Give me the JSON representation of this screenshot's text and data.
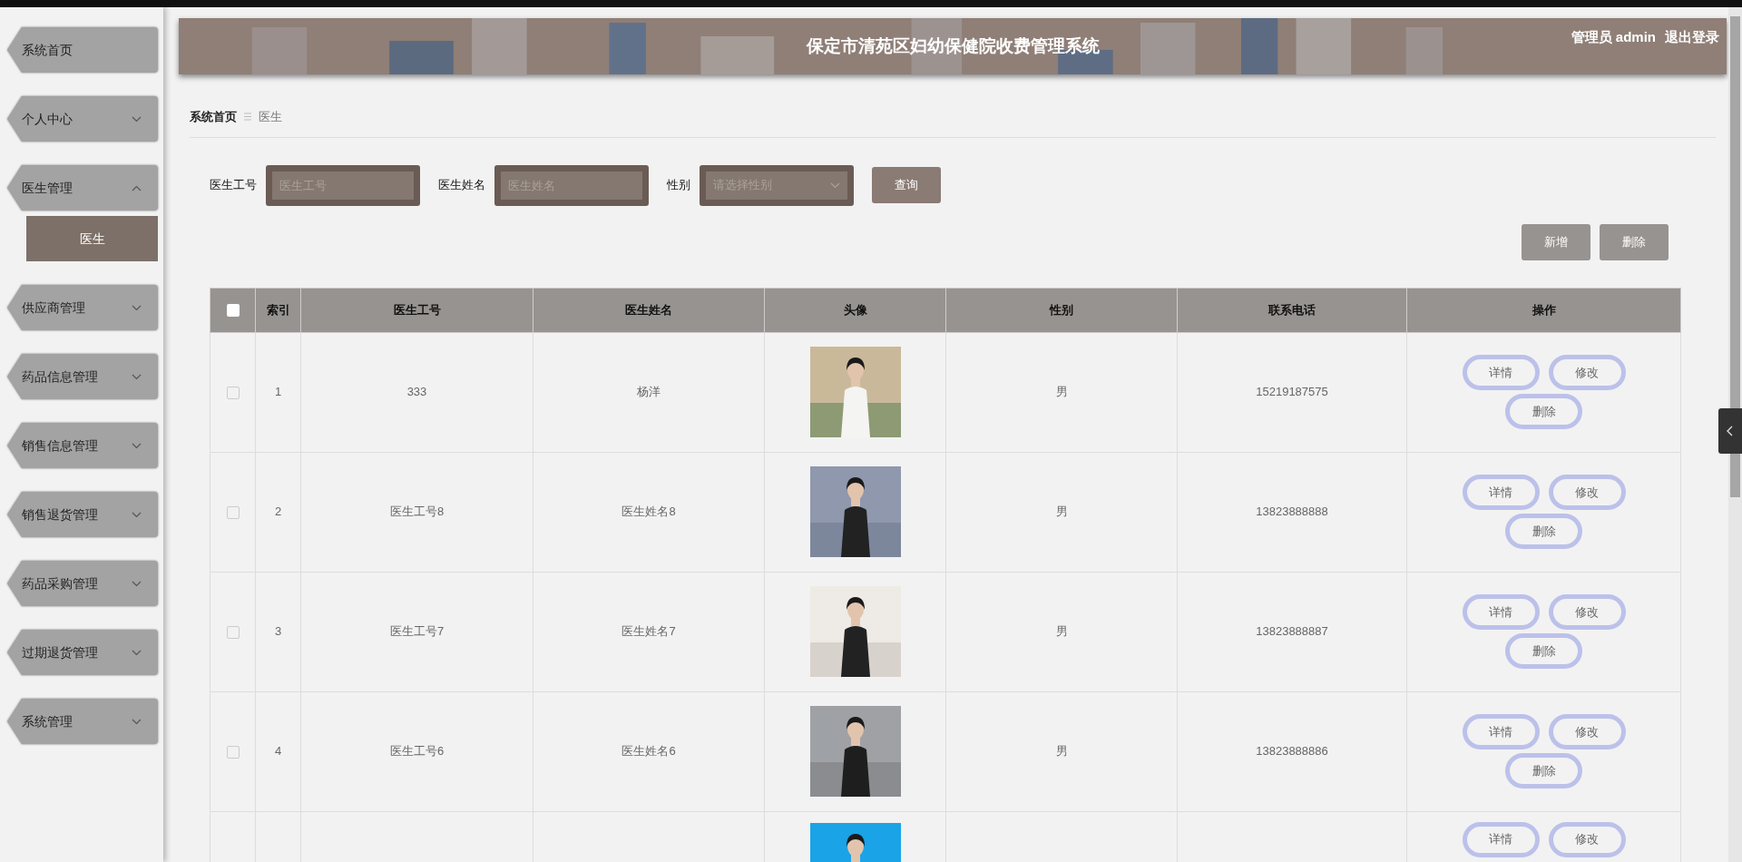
{
  "header": {
    "title": "保定市清苑区妇幼保健院收费管理系统",
    "user_role": "管理员",
    "username": "admin",
    "logout": "退出登录"
  },
  "sidebar": {
    "items": [
      {
        "label": "系统首页",
        "expandable": false
      },
      {
        "label": "个人中心",
        "expandable": true,
        "expanded": false
      },
      {
        "label": "医生管理",
        "expandable": true,
        "expanded": true,
        "children": [
          {
            "label": "医生",
            "selected": true
          }
        ]
      },
      {
        "label": "供应商管理",
        "expandable": true,
        "expanded": false
      },
      {
        "label": "药品信息管理",
        "expandable": true,
        "expanded": false
      },
      {
        "label": "销售信息管理",
        "expandable": true,
        "expanded": false
      },
      {
        "label": "销售退货管理",
        "expandable": true,
        "expanded": false
      },
      {
        "label": "药品采购管理",
        "expandable": true,
        "expanded": false
      },
      {
        "label": "过期退货管理",
        "expandable": true,
        "expanded": false
      },
      {
        "label": "系统管理",
        "expandable": true,
        "expanded": false
      }
    ]
  },
  "breadcrumb": [
    {
      "label": "系统首页",
      "current": false
    },
    {
      "label": "医生",
      "current": true
    }
  ],
  "search": {
    "fields": [
      {
        "kind": "text",
        "label": "医生工号",
        "placeholder": "医生工号"
      },
      {
        "kind": "text",
        "label": "医生姓名",
        "placeholder": "医生姓名"
      },
      {
        "kind": "select",
        "label": "性别",
        "placeholder": "请选择性别"
      }
    ],
    "button": "查询"
  },
  "actions": [
    "新增",
    "删除"
  ],
  "table": {
    "select_all_checked": false,
    "columns": [
      "索引",
      "医生工号",
      "医生姓名",
      "头像",
      "性别",
      "联系电话",
      "操作"
    ],
    "rows": [
      {
        "checked": false,
        "index": "1",
        "id": "333",
        "name": "杨洋",
        "gender": "男",
        "phone": "15219187575",
        "actions": [
          "详情",
          "修改",
          "删除"
        ]
      },
      {
        "checked": false,
        "index": "2",
        "id": "医生工号8",
        "name": "医生姓名8",
        "gender": "男",
        "phone": "13823888888",
        "actions": [
          "详情",
          "修改",
          "删除"
        ]
      },
      {
        "checked": false,
        "index": "3",
        "id": "医生工号7",
        "name": "医生姓名7",
        "gender": "男",
        "phone": "13823888887",
        "actions": [
          "详情",
          "修改",
          "删除"
        ]
      },
      {
        "checked": false,
        "index": "4",
        "id": "医生工号6",
        "name": "医生姓名6",
        "gender": "男",
        "phone": "13823888886",
        "actions": [
          "详情",
          "修改",
          "删除"
        ]
      },
      {
        "actions": [
          "详情",
          "修改"
        ]
      }
    ]
  }
}
